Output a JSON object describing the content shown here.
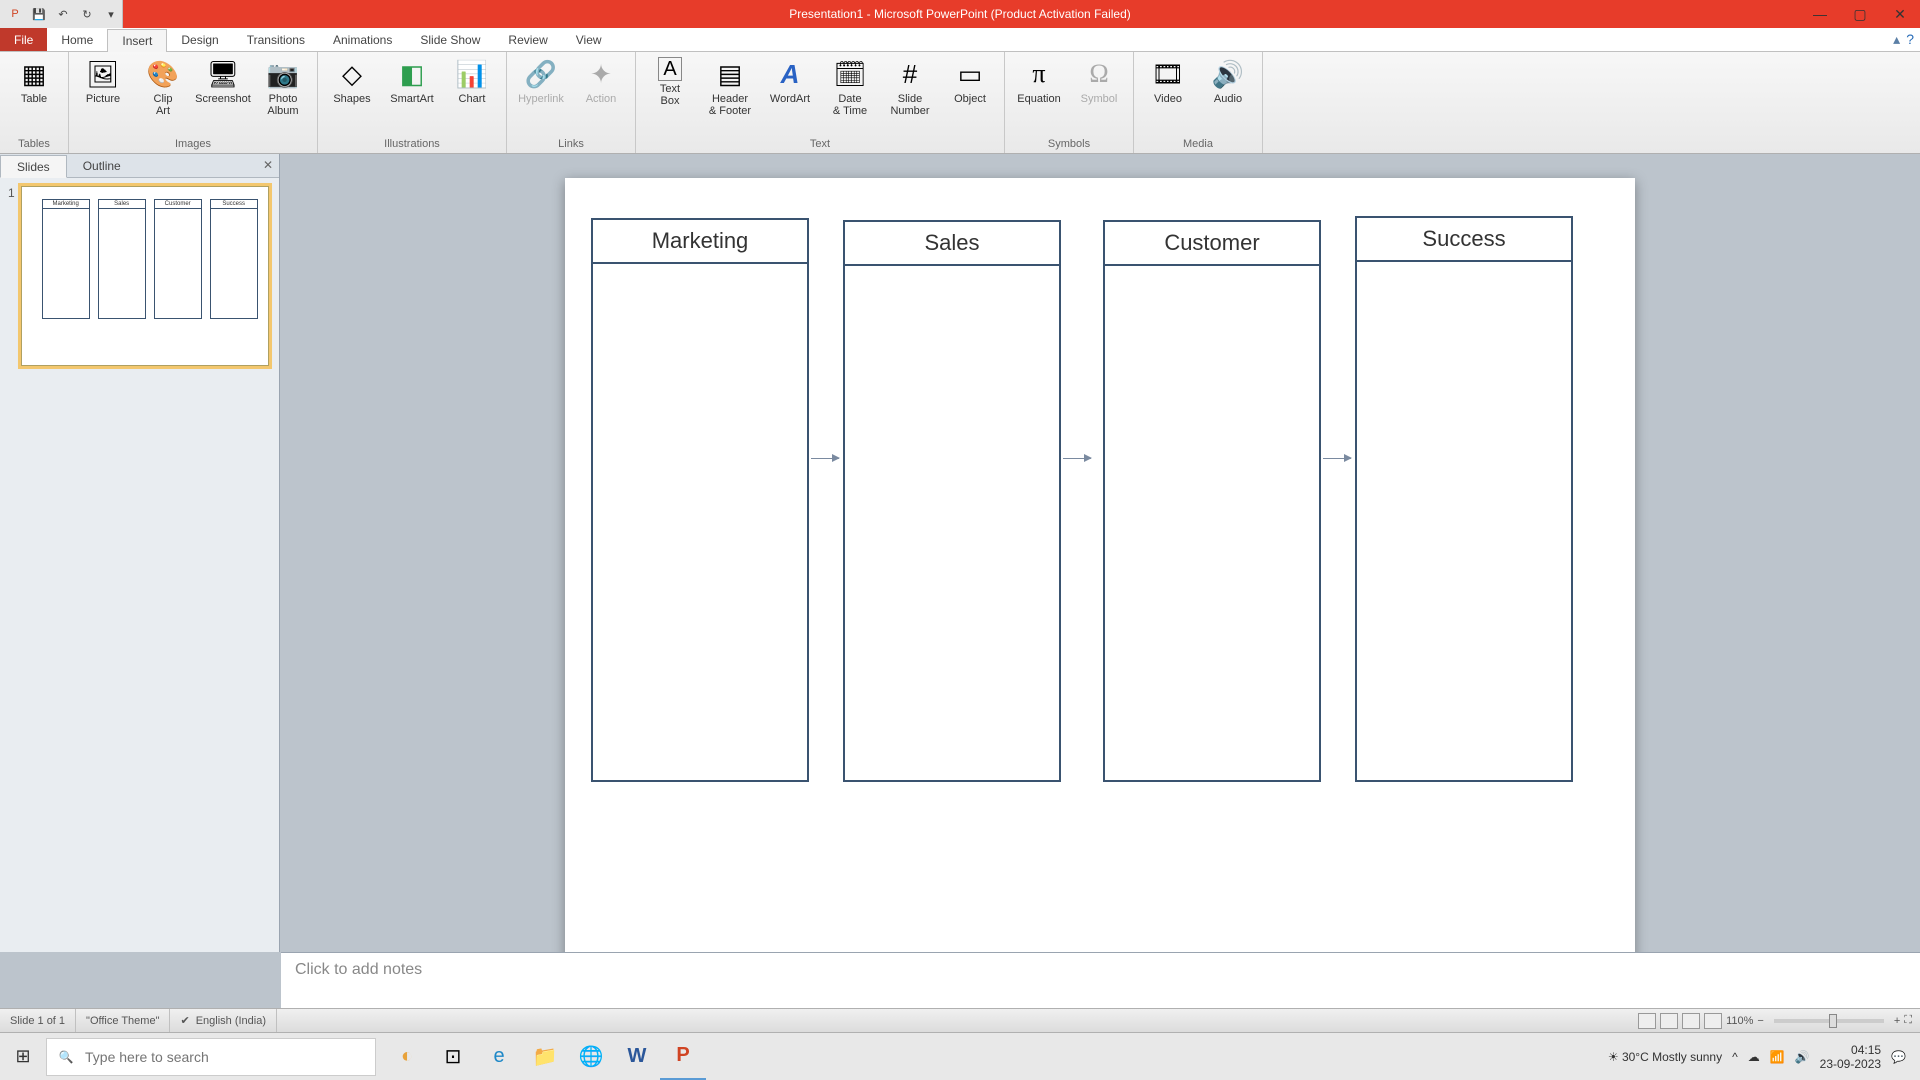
{
  "window": {
    "title": "Presentation1 - Microsoft PowerPoint (Product Activation Failed)"
  },
  "qat": {
    "save": "💾",
    "undo": "↶",
    "redo": "↻"
  },
  "tabs": {
    "file": "File",
    "home": "Home",
    "insert": "Insert",
    "design": "Design",
    "transitions": "Transitions",
    "animations": "Animations",
    "slideshow": "Slide Show",
    "review": "Review",
    "view": "View"
  },
  "ribbon": {
    "tables": {
      "label": "Tables",
      "table": "Table"
    },
    "images": {
      "label": "Images",
      "picture": "Picture",
      "clipart": "Clip\nArt",
      "screenshot": "Screenshot",
      "photoalbum": "Photo\nAlbum"
    },
    "illustrations": {
      "label": "Illustrations",
      "shapes": "Shapes",
      "smartart": "SmartArt",
      "chart": "Chart"
    },
    "links": {
      "label": "Links",
      "hyperlink": "Hyperlink",
      "action": "Action"
    },
    "text": {
      "label": "Text",
      "textbox": "Text\nBox",
      "headerfooter": "Header\n& Footer",
      "wordart": "WordArt",
      "datetime": "Date\n& Time",
      "slidenumber": "Slide\nNumber",
      "object": "Object"
    },
    "symbols": {
      "label": "Symbols",
      "equation": "Equation",
      "symbol": "Symbol"
    },
    "media": {
      "label": "Media",
      "video": "Video",
      "audio": "Audio"
    }
  },
  "panel": {
    "slides": "Slides",
    "outline": "Outline",
    "num": "1"
  },
  "slide": {
    "columns": [
      "Marketing",
      "Sales",
      "Customer",
      "Success"
    ]
  },
  "notes": {
    "placeholder": "Click to add notes"
  },
  "status": {
    "slide": "Slide 1 of 1",
    "theme": "\"Office Theme\"",
    "lang": "English (India)",
    "zoom": "110%"
  },
  "taskbar": {
    "search_placeholder": "Type here to search",
    "weather": "30°C  Mostly sunny",
    "time": "04:15",
    "date": "23-09-2023"
  }
}
